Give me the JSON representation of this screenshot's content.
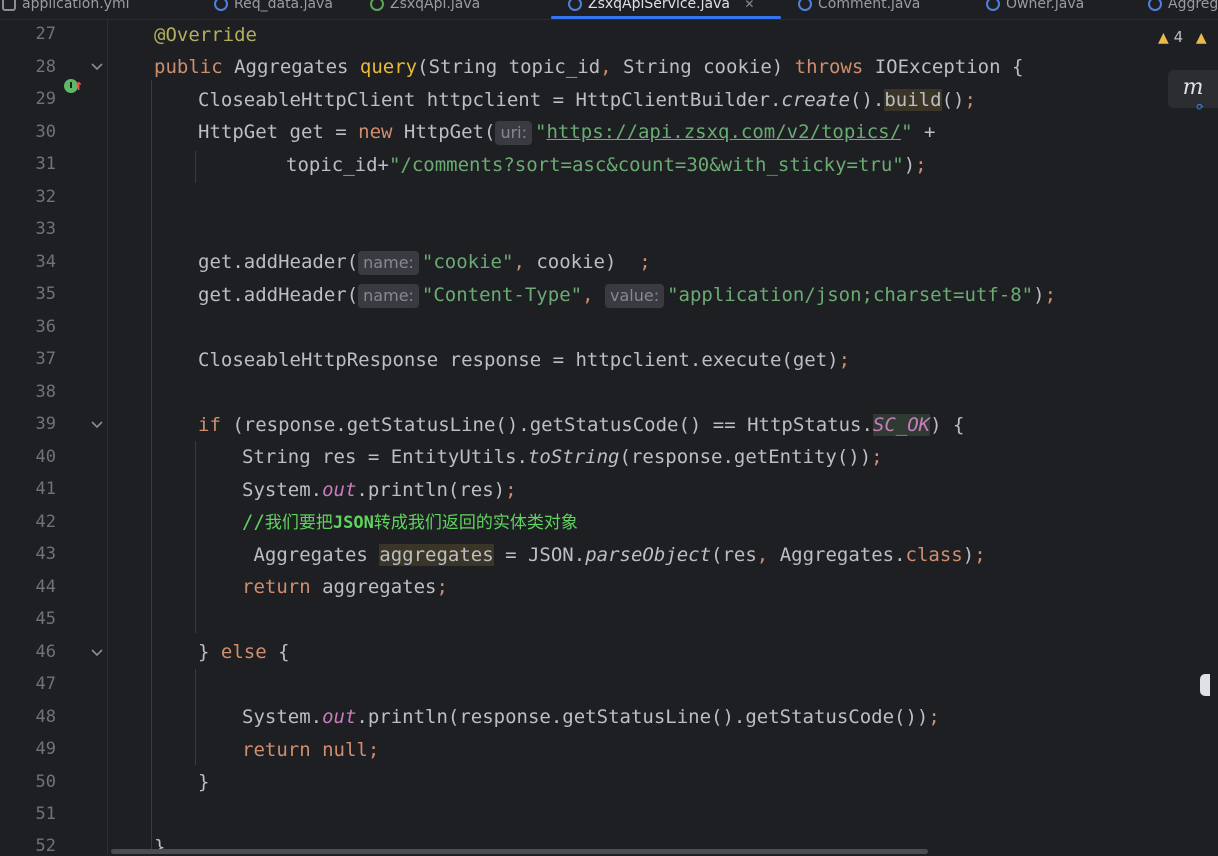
{
  "tabs": [
    {
      "label": "application.yml",
      "icon": "yml-file-icon"
    },
    {
      "label": "Req_data.java",
      "icon": "java-class-icon"
    },
    {
      "label": "ZsxqApi.java",
      "icon": "java-interface-icon"
    },
    {
      "label": "ZsxqApiService.java",
      "icon": "java-class-icon",
      "active": true
    },
    {
      "label": "Comment.java",
      "icon": "java-class-icon"
    },
    {
      "label": "Owner.java",
      "icon": "java-class-icon"
    },
    {
      "label": "Aggreg",
      "icon": "java-class-icon"
    }
  ],
  "inspections": {
    "warning_count": "4"
  },
  "plugin_button": {
    "label": "m"
  },
  "line_numbers": [
    "27",
    "28",
    "29",
    "30",
    "31",
    "32",
    "33",
    "34",
    "35",
    "36",
    "37",
    "38",
    "39",
    "40",
    "41",
    "42",
    "43",
    "44",
    "45",
    "46",
    "47",
    "48",
    "49",
    "50",
    "51",
    "52"
  ],
  "code": {
    "l27": {
      "annotation": "@Override"
    },
    "l28": {
      "kw1": "public",
      "type": " Aggregates ",
      "name": "query",
      "params": "(String topic_id",
      "comma": ",",
      "params2": " String cookie) ",
      "throws": "throws",
      "rest": " IOException {"
    },
    "l29": {
      "a": "CloseableHttpClient httpclient = HttpClientBuilder.",
      "b": "create",
      "c": "().",
      "d": "build",
      "e": "()",
      "semi": ";"
    },
    "l30": {
      "a": "HttpGet get = ",
      "kw": "new",
      "b": " HttpGet(",
      "hint": "uri:",
      "url_q1": "\"",
      "url": "https://api.zsxq.com/v2/topics/",
      "url_q2": "\"",
      "plus": " +"
    },
    "l31": {
      "a": "topic_id+",
      "str": "\"/comments?sort=asc&count=30&with_sticky=tru\"",
      "b": ")",
      "semi": ";"
    },
    "l34": {
      "a": "get.addHeader(",
      "hint": "name:",
      "str": "\"cookie\"",
      "comma": ",",
      "b": " cookie)  ",
      "semi": ";"
    },
    "l35": {
      "a": "get.addHeader(",
      "hint": "name:",
      "str1": "\"Content-Type\"",
      "comma": ",",
      "hint2": "value:",
      "str2": "\"application/json;charset=utf-8\"",
      "b": ")",
      "semi": ";"
    },
    "l37": {
      "a": "CloseableHttpResponse response = httpclient.execute(get)",
      "semi": ";"
    },
    "l39": {
      "kw": "if",
      "a": " (response.getStatusLine().getStatusCode() == HttpStatus.",
      "const": "SC_OK",
      "b": ") {"
    },
    "l40": {
      "a": "String res = EntityUtils.",
      "b": "toString",
      "c": "(response.getEntity())",
      "semi": ";"
    },
    "l41": {
      "a": "System.",
      "field": "out",
      "b": ".println(res)",
      "semi": ";"
    },
    "l42": {
      "slashes": "//",
      "t1": "我们要把",
      "t2": "JSON",
      "t3": "转成我们返回的实体类对象"
    },
    "l43": {
      "a": " Aggregates ",
      "var": "aggregates",
      "b": " = JSON.",
      "c": "parseObject",
      "d": "(res",
      "comma": ",",
      "e": " Aggregates.",
      "cls": "class",
      "f": ")",
      "semi": ";"
    },
    "l44": {
      "kw": "return",
      "a": " aggregates",
      "semi": ";"
    },
    "l46": {
      "a": "} ",
      "kw": "else",
      "b": " {"
    },
    "l48": {
      "a": "System.",
      "field": "out",
      "b": ".println(response.getStatusLine().getStatusCode())",
      "semi": ";"
    },
    "l49": {
      "kw": "return",
      "kw2": " null",
      "semi": ";"
    },
    "l50": {
      "a": "}"
    },
    "l52": {
      "a": "}"
    }
  },
  "colors": {
    "background": "#1e1f22",
    "keyword": "#cf8e6d",
    "string": "#6aab73",
    "annotation": "#b3ae60",
    "accent": "#3574f0"
  }
}
